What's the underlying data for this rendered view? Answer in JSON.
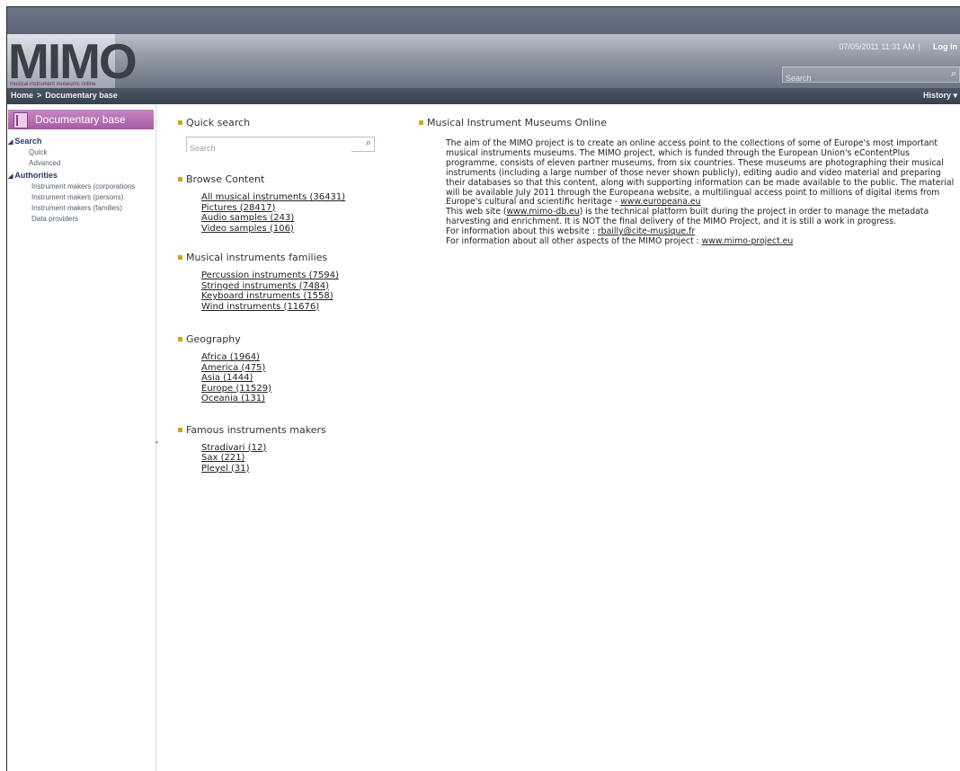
{
  "header": {
    "logo": "MIMO",
    "logo_subtitle": "musical instrument museums online",
    "datetime": "07/05/2011 11:31 AM",
    "separator": "|",
    "login": "Log in",
    "search_placeholder": "Search"
  },
  "navbar": {
    "breadcrumb_home": "Home",
    "breadcrumb_arrow": ">",
    "breadcrumb_current": "Documentary base",
    "history": "History"
  },
  "sidebar": {
    "title": "Documentary base",
    "search_section": "Search",
    "search_items": [
      "Quick",
      "Advanced"
    ],
    "authorities_section": "Authorities",
    "authorities_items": [
      "Instrument makers (corporations",
      "Instrument makers (persons)",
      "Instrument makers (families)",
      "Data providers"
    ]
  },
  "quick_search": {
    "title": "Quick search",
    "placeholder": "Search"
  },
  "browse": {
    "title": "Browse Content",
    "links": [
      "All musical instruments (36431)",
      "Pictures (28417)",
      "Audio samples (243)",
      "Video samples (106)"
    ]
  },
  "families": {
    "title": "Musical instruments families",
    "links": [
      "Percussion instruments (7594)",
      "Stringed instruments (7484)",
      "Keyboard instruments (1558)",
      "Wind instruments (11676)"
    ]
  },
  "geography": {
    "title": "Geography",
    "links": [
      "Africa (1964)",
      "America (475)",
      "Asia (1444)",
      "Europe (11529)",
      "Oceania (131)"
    ]
  },
  "makers": {
    "title": "Famous instruments makers",
    "links": [
      "Stradivari (12)",
      "Sax (221)",
      "Pleyel (31)"
    ]
  },
  "main": {
    "title": "Musical Instrument Museums Online",
    "para1_text": "The aim of the MIMO project is to create an online access point to the collections of some of Europe's most important musical instruments museums. The MIMO project, which is funded through the European Union's eContentPlus programme, consists of eleven partner museums, from six countries. These museums are photographing their musical instruments (including a large number of those never shown publicly), editing audio and video material and preparing their databases so that this content, along with supporting information can be made available to the public. The material will be available July 2011 through the Europeana website, a multilingual access point to millions of digital items from Europe's cultural and scientific heritage - ",
    "para1_link": "www.europeana.eu",
    "para2_pre": "This web site (",
    "para2_link": "www.mimo-db.eu",
    "para2_post": ") is the technical platform built during the project in order to manage the metadata harvesting and enrichment. It is NOT the final delivery of the MIMO Project, and it is still a work in progress.",
    "para3_pre": "For information about this website : ",
    "para3_link": "rbailly@cite-musique.fr",
    "para4_pre": "For information about all other aspects of the MIMO project : ",
    "para4_link": "www.mimo-project.eu"
  },
  "colors": {
    "bullet": "#c8a81a",
    "sidebar_title_bg": "#b56bb1",
    "navbar_bg": "#434b58"
  }
}
